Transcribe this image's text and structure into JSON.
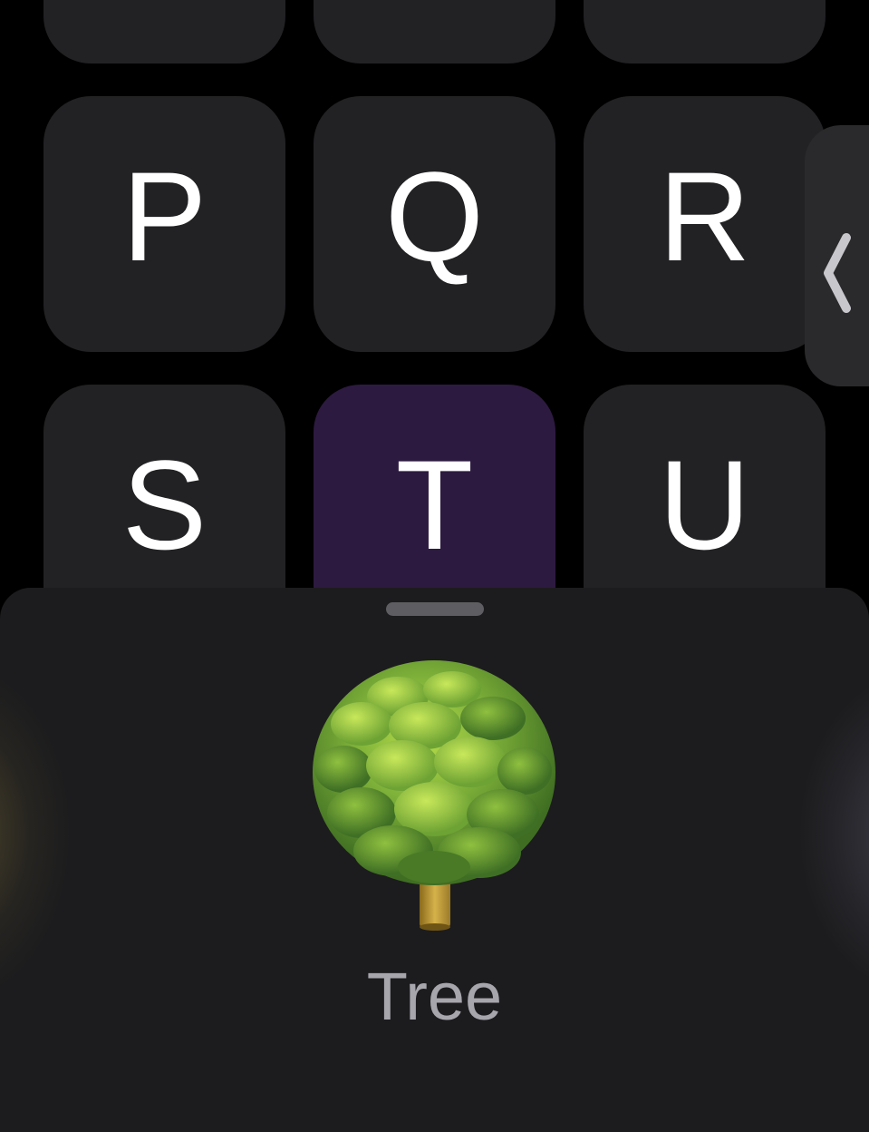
{
  "keypad": {
    "row_p": [
      "P",
      "Q",
      "R"
    ],
    "row_s": [
      "S",
      "T",
      "U"
    ],
    "selected_key": "T"
  },
  "side_tab": {
    "icon": "chevron-left-icon"
  },
  "sheet": {
    "emoji_icon": "deciduous-tree-icon",
    "caption": "Tree"
  },
  "colors": {
    "background": "#000000",
    "key": "#222224",
    "key_selected": "#2d1a40",
    "sheet": "#1c1c1e",
    "caption": "#a7a6ac"
  }
}
